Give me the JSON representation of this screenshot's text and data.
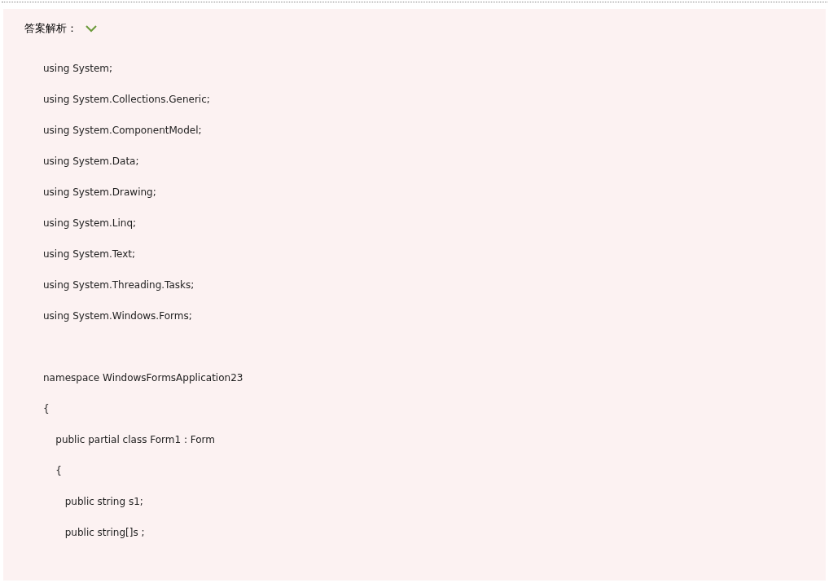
{
  "answer_section": {
    "title": "答案解析：",
    "expanded": true,
    "code_lines": [
      {
        "text": "using System;",
        "gap_before": false
      },
      {
        "text": "using System.Collections.Generic;",
        "gap_before": false
      },
      {
        "text": "using System.ComponentModel;",
        "gap_before": false
      },
      {
        "text": "using System.Data;",
        "gap_before": false
      },
      {
        "text": "using System.Drawing;",
        "gap_before": false
      },
      {
        "text": "using System.Linq;",
        "gap_before": false
      },
      {
        "text": "using System.Text;",
        "gap_before": false
      },
      {
        "text": "using System.Threading.Tasks;",
        "gap_before": false
      },
      {
        "text": "using System.Windows.Forms;",
        "gap_before": false
      },
      {
        "text": "namespace WindowsFormsApplication23",
        "gap_before": true
      },
      {
        "text": "{",
        "gap_before": false
      },
      {
        "text": "    public partial class Form1 : Form",
        "gap_before": false
      },
      {
        "text": "    {",
        "gap_before": false
      },
      {
        "text": "       public string s1;",
        "gap_before": false
      },
      {
        "text": "       public string[]s ;",
        "gap_before": false
      }
    ]
  }
}
